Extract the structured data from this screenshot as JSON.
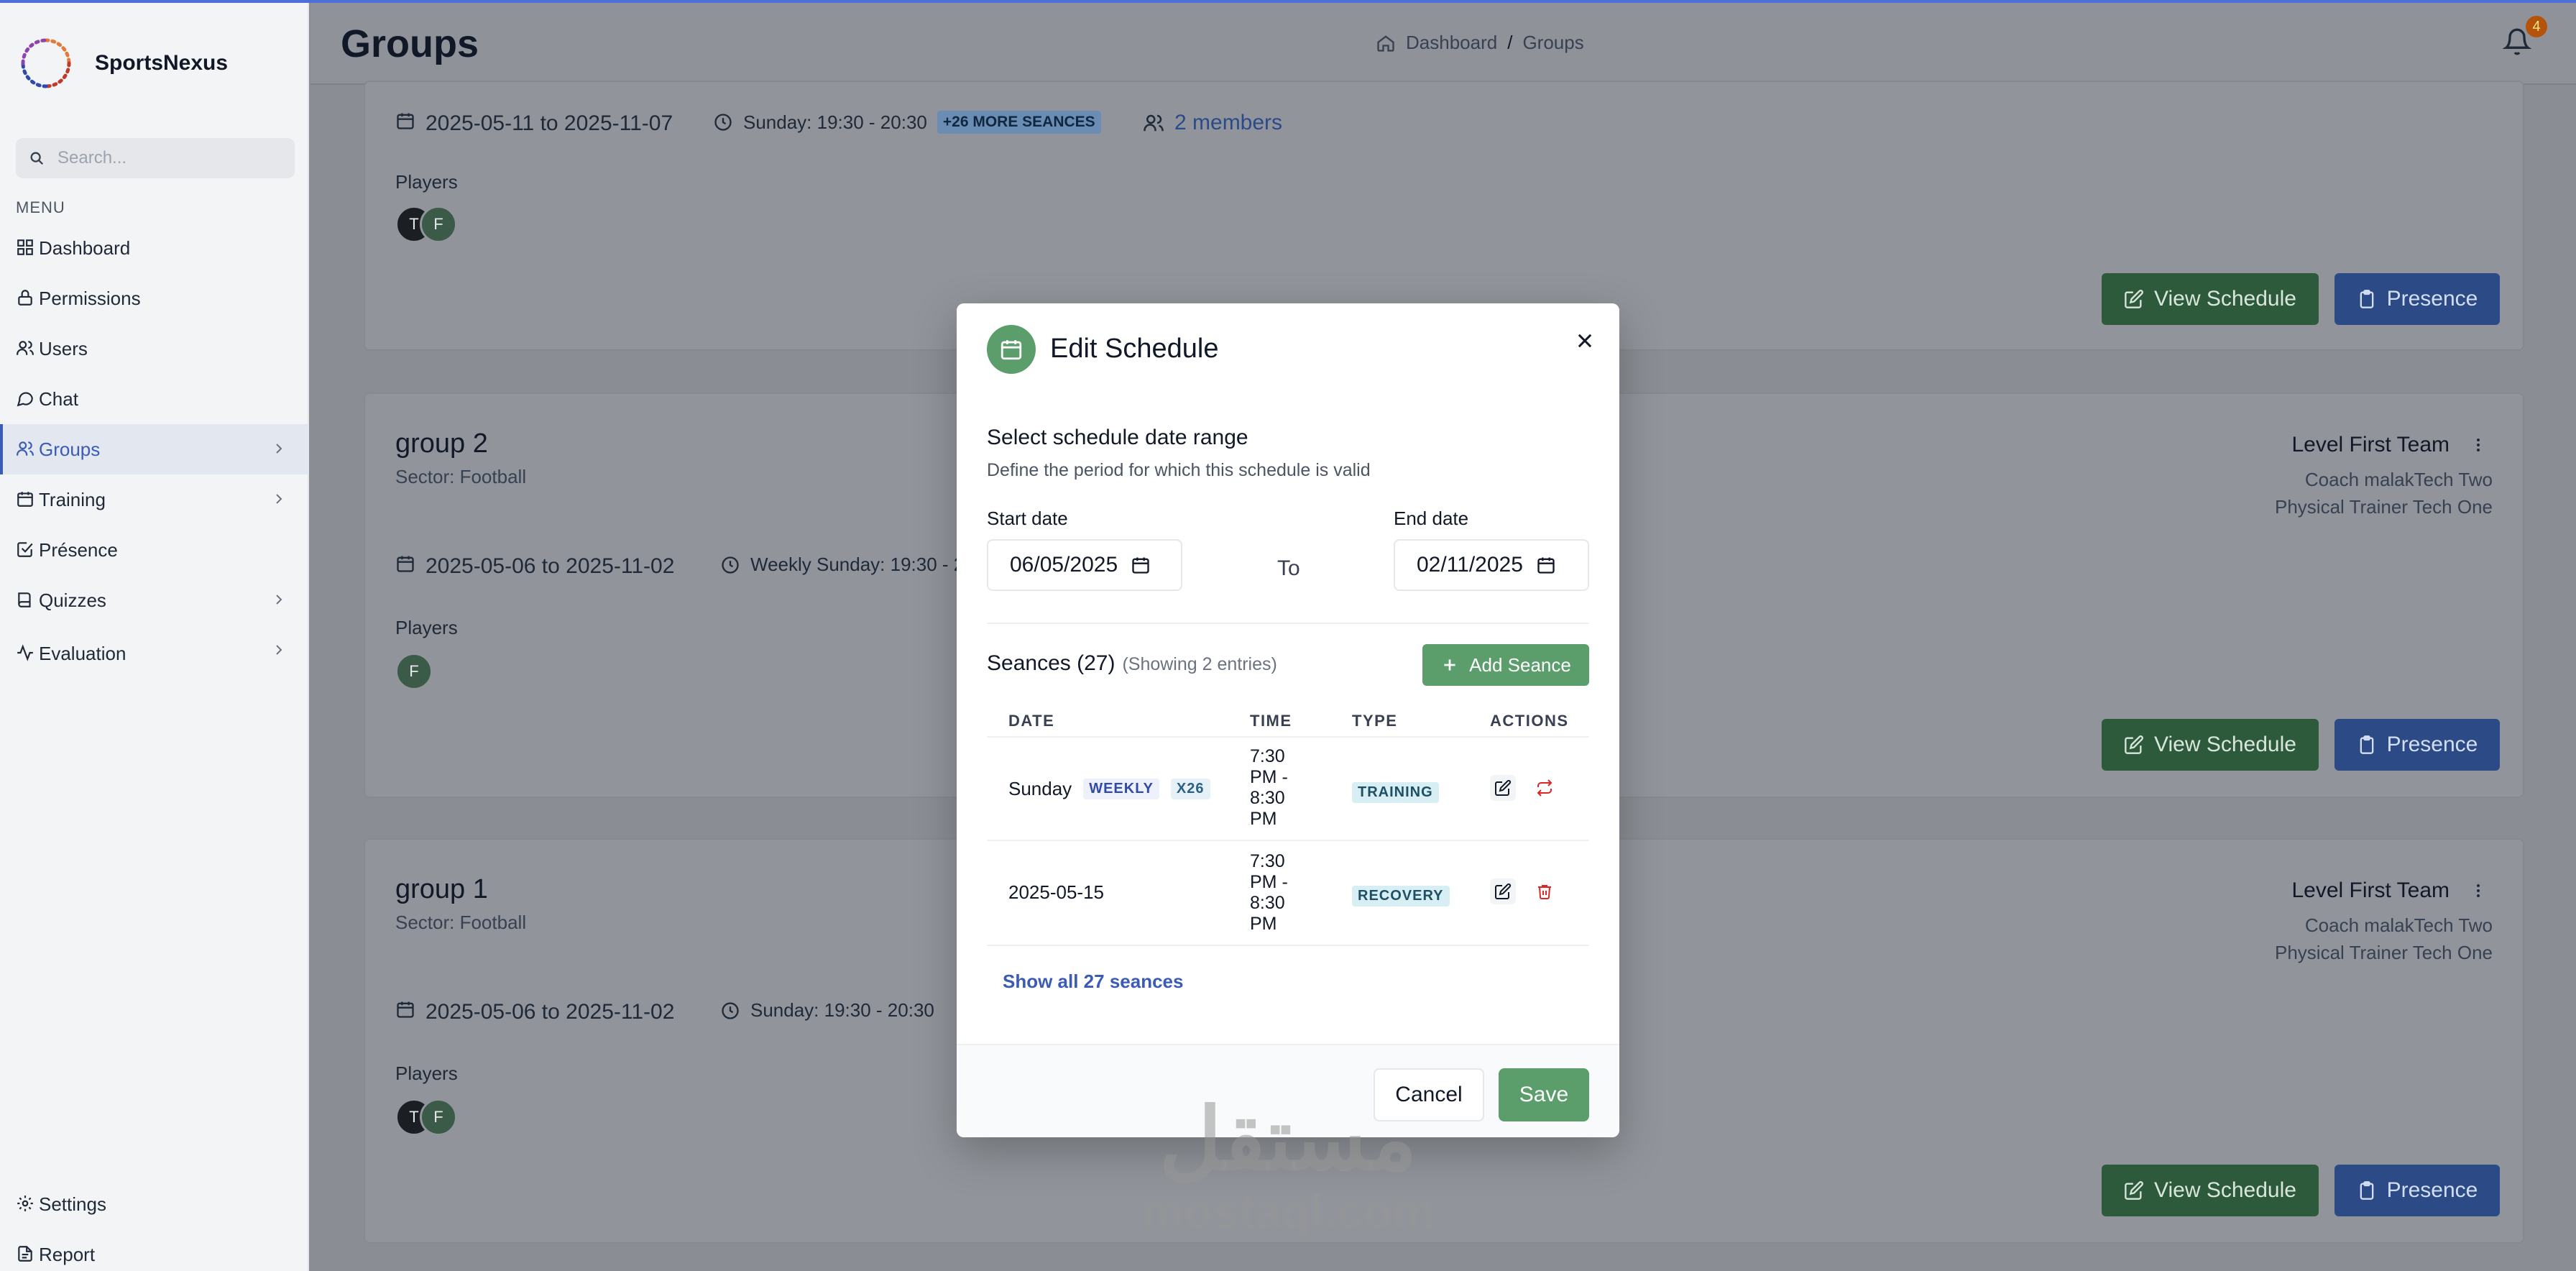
{
  "brand": {
    "name": "SportsNexus"
  },
  "search": {
    "placeholder": "Search..."
  },
  "sidebar": {
    "menu_label": "MENU",
    "items": [
      {
        "label": "Dashboard",
        "icon": "grid-icon"
      },
      {
        "label": "Permissions",
        "icon": "lock-icon"
      },
      {
        "label": "Users",
        "icon": "users-icon"
      },
      {
        "label": "Chat",
        "icon": "chat-icon"
      },
      {
        "label": "Groups",
        "icon": "users-icon"
      },
      {
        "label": "Training",
        "icon": "calendar-icon"
      },
      {
        "label": "Présence",
        "icon": "check-square-icon"
      },
      {
        "label": "Quizzes",
        "icon": "book-icon"
      },
      {
        "label": "Evaluation",
        "icon": "activity-icon"
      }
    ],
    "bottom": [
      {
        "label": "Settings",
        "icon": "gear-icon"
      },
      {
        "label": "Report",
        "icon": "file-icon"
      }
    ]
  },
  "header": {
    "title": "Groups",
    "breadcrumb": {
      "home": "Dashboard",
      "separator": "/",
      "current": "Groups"
    },
    "notifications": "4"
  },
  "groups": [
    {
      "dates": "2025-05-11 to 2025-11-07",
      "schedule": "Sunday: 19:30 - 20:30",
      "more": "+26 MORE SEANCES",
      "members": "2 members",
      "players_label": "Players",
      "players": [
        "T",
        "F"
      ],
      "view_label": "View Schedule",
      "presence_label": "Presence"
    },
    {
      "name": "group 2",
      "sector": "Sector: Football",
      "dates": "2025-05-06 to 2025-11-02",
      "schedule": "Weekly Sunday: 19:30 - 2",
      "level": "Level First Team",
      "coach": "Coach malakTech Two",
      "trainer": "Physical Trainer Tech One",
      "players_label": "Players",
      "players": [
        "F"
      ],
      "view_label": "View Schedule",
      "presence_label": "Presence"
    },
    {
      "name": "group 1",
      "sector": "Sector: Football",
      "dates": "2025-05-06 to 2025-11-02",
      "schedule": "Sunday: 19:30 - 20:30",
      "level": "Level First Team",
      "coach": "Coach malakTech Two",
      "trainer": "Physical Trainer Tech One",
      "players_label": "Players",
      "players": [
        "T",
        "F"
      ],
      "view_label": "View Schedule",
      "presence_label": "Presence"
    }
  ],
  "modal": {
    "title": "Edit Schedule",
    "section_title": "Select schedule date range",
    "section_desc": "Define the period for which this schedule is valid",
    "start_label": "Start date",
    "start_value": "06/05/2025",
    "to_label": "To",
    "end_label": "End date",
    "end_value": "02/11/2025",
    "seances_title": "Seances (27)",
    "seances_showing": "(Showing 2 entries)",
    "add_label": "Add Seance",
    "columns": [
      "DATE",
      "TIME",
      "TYPE",
      "ACTIONS"
    ],
    "rows": [
      {
        "date": "Sunday",
        "tags": [
          "WEEKLY",
          "X26"
        ],
        "time": "7:30 PM - 8:30 PM",
        "type": "TRAINING"
      },
      {
        "date": "2025-05-15",
        "tags": [],
        "time": "7:30 PM - 8:30 PM",
        "type": "RECOVERY"
      }
    ],
    "show_all": "Show all 27 seances",
    "cancel_label": "Cancel",
    "save_label": "Save"
  },
  "watermark": {
    "arabic": "مستقل",
    "latin": "mostaql.com"
  },
  "colors": {
    "accent": "#3b5bb5",
    "green": "#5b9e6c",
    "danger": "#dc2626"
  }
}
